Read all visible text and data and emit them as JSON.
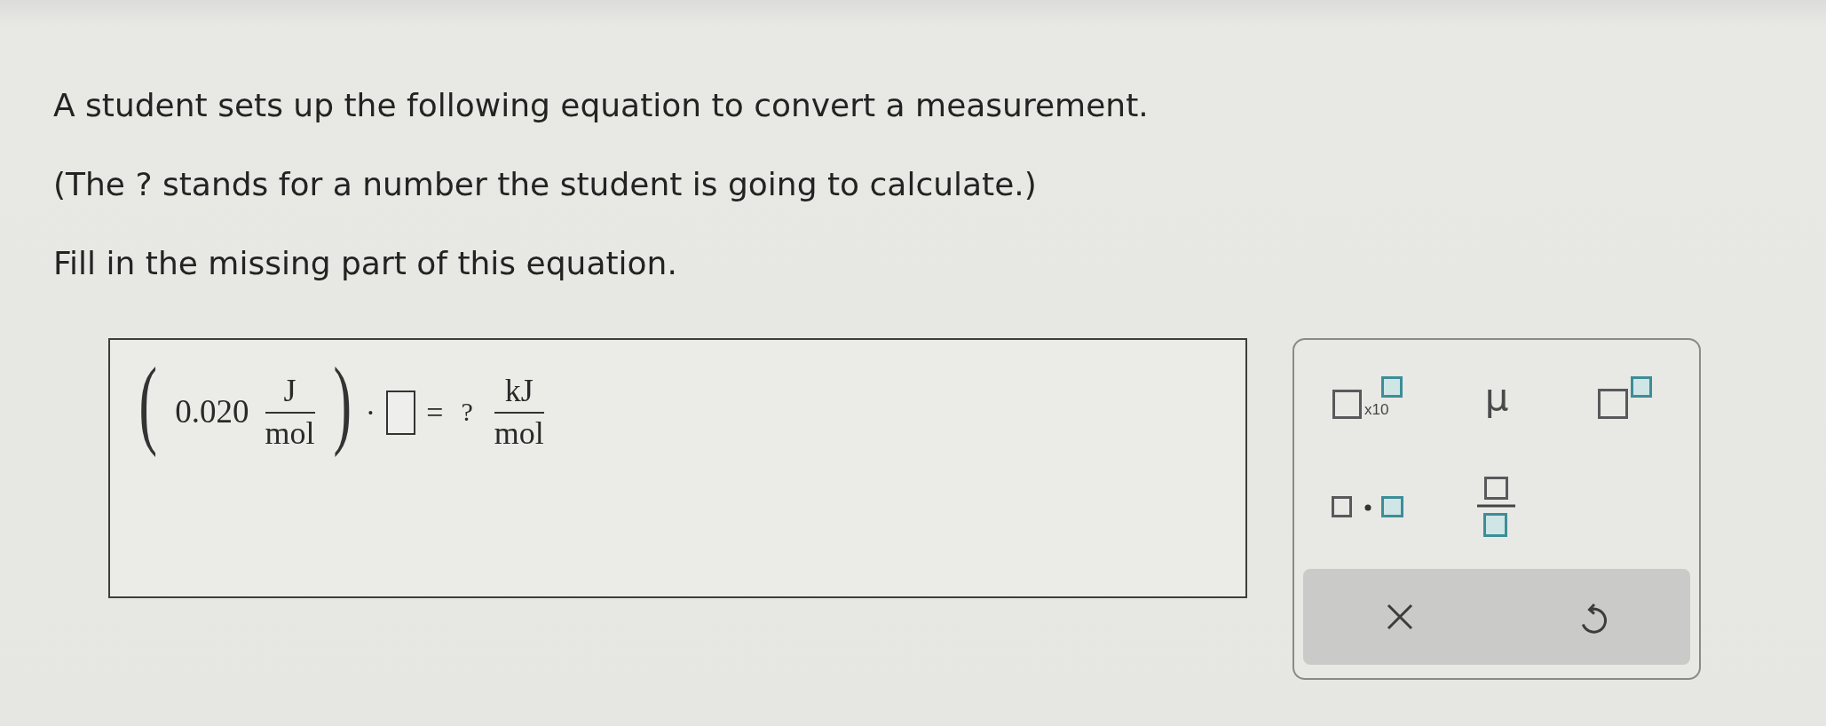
{
  "question": {
    "paragraphs": [
      "A student sets up the following equation to convert a measurement.",
      "(The ? stands for a number the student is going to calculate.)",
      "Fill in the missing part of this equation."
    ]
  },
  "equation": {
    "terms": [
      {
        "kind": "delimiter",
        "text": "("
      },
      {
        "kind": "number",
        "text": "0.020"
      },
      {
        "kind": "fraction",
        "numerator": "J",
        "denominator": "mol"
      },
      {
        "kind": "delimiter",
        "text": ")"
      },
      {
        "kind": "operator",
        "text": "·"
      },
      {
        "kind": "blank"
      },
      {
        "kind": "operator",
        "text": "="
      },
      {
        "kind": "unknown",
        "text": "?"
      },
      {
        "kind": "fraction",
        "numerator": "kJ",
        "denominator": "mol"
      }
    ]
  },
  "palette": {
    "buttons": [
      {
        "kind": "scientific",
        "label": "x10"
      },
      {
        "kind": "symbol",
        "label": "μ"
      },
      {
        "kind": "power"
      },
      {
        "kind": "product"
      },
      {
        "kind": "fraction"
      }
    ],
    "actions": [
      {
        "kind": "clear"
      },
      {
        "kind": "undo"
      }
    ]
  }
}
